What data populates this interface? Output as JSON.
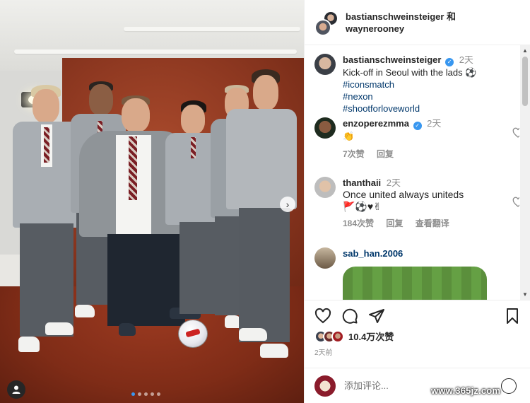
{
  "header": {
    "names_line1": "bastianschweinsteiger 和",
    "names_line2": "waynerooney"
  },
  "caption": {
    "user": "bastianschweinsteiger",
    "time": "2天",
    "text": "Kick-off in Seoul with the lads ⚽",
    "hashtags": [
      "#iconsmatch",
      "#nexon",
      "#shootforloveworld"
    ]
  },
  "comments": [
    {
      "user": "enzoperezmma",
      "verified": true,
      "time": "2天",
      "text": "👏",
      "likes": "7次赞",
      "reply": "回复"
    },
    {
      "user": "thanthaii",
      "verified": false,
      "time": "2天",
      "text": "Once united always uniteds",
      "text2": "🚩⚽♥✌",
      "likes": "184次赞",
      "reply": "回复",
      "translate": "查看翻译"
    },
    {
      "user": "sab_han.2006"
    }
  ],
  "likes": {
    "count_text": "10.4万次赞"
  },
  "post_time": "2天前",
  "add_comment": {
    "placeholder": "添加评论..."
  },
  "watermark": "www.365jz.com",
  "carousel": {
    "total_images": 5,
    "active_index": 0
  },
  "icons": {
    "like": "heart-icon",
    "comment": "comment-icon",
    "share": "share-icon",
    "save": "bookmark-icon",
    "emoji": "emoji-icon",
    "next": "chevron-right-icon",
    "tag": "person-tag-icon"
  },
  "colors": {
    "link": "#00376b",
    "verified": "#3897f0",
    "meta": "#8e8e8e"
  }
}
